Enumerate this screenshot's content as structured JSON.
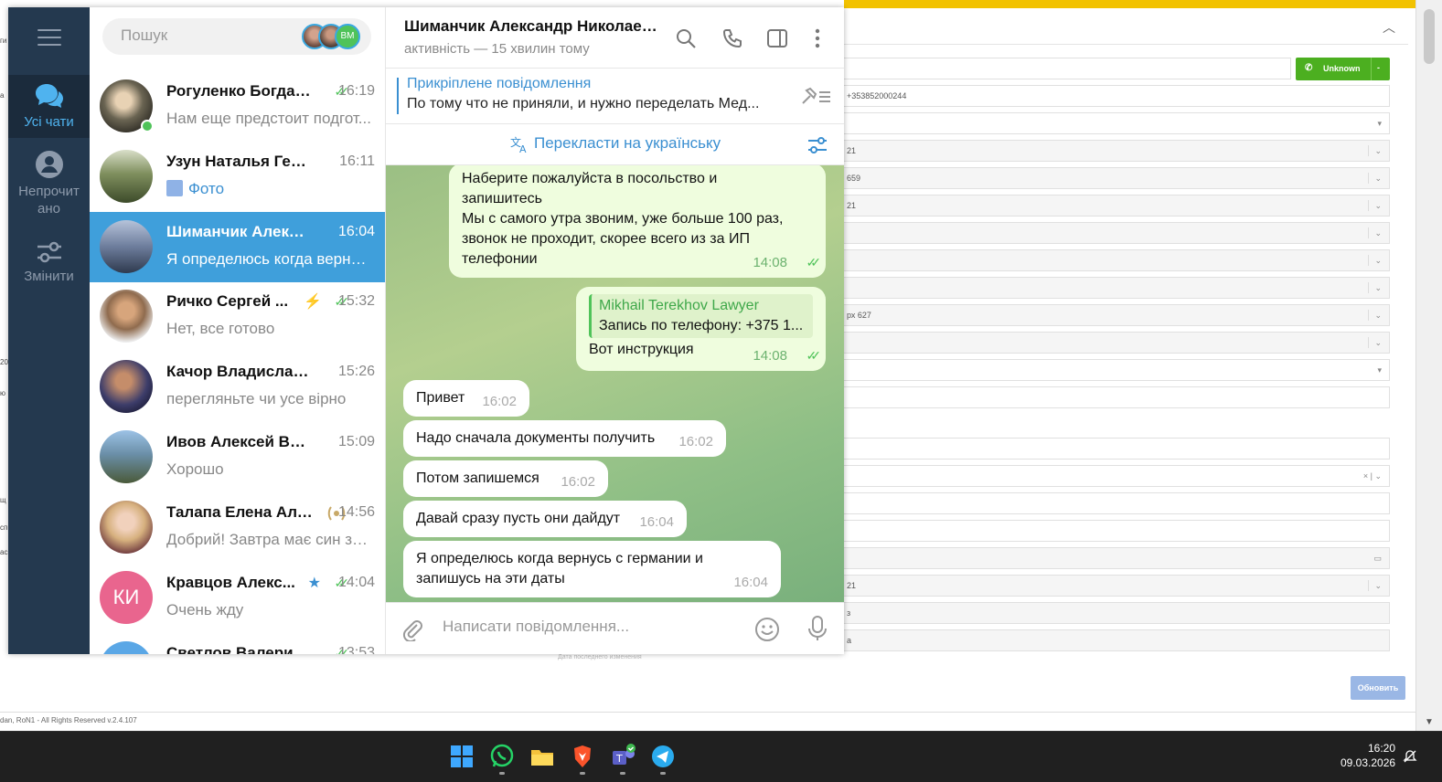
{
  "background_app": {
    "phone_value": "+353852000244",
    "unknown_label": "Unknown",
    "field_snippets": [
      "21",
      "659",
      "21",
      "рх 627",
      "21",
      "з",
      "а"
    ],
    "update_label": "Обновить",
    "footer": "dan, RoN1 - All Rights Reserved v.2.4.107",
    "left_scraps": [
      "ги",
      "а",
      "20",
      "ю",
      "щ",
      "сп",
      "ас"
    ],
    "bottom_scrap": "Дата последнего изменения"
  },
  "telegram": {
    "rail": [
      {
        "label": "Усі чати",
        "icon": "chats-icon"
      },
      {
        "label": "Непрочит ано",
        "icon": "unread-icon"
      },
      {
        "label": "Змінити",
        "icon": "edit-filters-icon"
      }
    ],
    "search": {
      "placeholder": "Пошук",
      "mini_avatar_text": "ВМ"
    },
    "chats": [
      {
        "name": "Рогуленко Богдан...",
        "time": "16:19",
        "preview": "Нам еще предстоит подгот...",
        "ticks": "✓✓"
      },
      {
        "name": "Узун Наталья Георги...",
        "time": "16:11",
        "preview": "Фото"
      },
      {
        "name": "Шиманчик Александ...",
        "time": "16:04",
        "preview": "Я определюсь когда вернус..."
      },
      {
        "name": "Ричко Сергей ...",
        "time": "15:32",
        "preview": "Нет, все готово",
        "ticks": "✓✓",
        "badge": "⚡"
      },
      {
        "name": "Качор Владислав Ол...",
        "time": "15:26",
        "preview": "перегляньте чи усе вірно"
      },
      {
        "name": "Ивов Алексей Викто...",
        "time": "15:09",
        "preview": "Хорошо"
      },
      {
        "name": "Талапа Елена Але...",
        "time": "14:56",
        "preview": "Добрий! Завтра має син за..."
      },
      {
        "name": "Кравцов Алекс...",
        "time": "14:04",
        "preview": "Очень жду",
        "ticks": "✓✓",
        "badge": "★",
        "initials": "КИ"
      },
      {
        "name": "Светлов Валерий...",
        "time": "13:53",
        "ticks": "✓✓"
      }
    ],
    "chat": {
      "title": "Шиманчик Александр Николаев...",
      "status": "активність — 15 хвилин тому",
      "pinned_title": "Прикріплене повідомлення",
      "pinned_text": "По тому что не приняли, и нужно переделать Мед...",
      "translate_label": "Перекласти на українську",
      "messages": [
        {
          "dir": "out",
          "text_lines": [
            "Наберите пожалуйста в посольство и",
            "запишитесь",
            "Мы с самого утра звоним, уже больше 100 раз,",
            "звонок не проходит, скорее всего из за ИП",
            "телефонии"
          ],
          "time": "14:08",
          "ticks": "✓✓"
        },
        {
          "dir": "out",
          "quote_author": "Mikhail Terekhov Lawyer",
          "quote_text": "Запись по телефону: +375 1...",
          "text": "Вот инструкция",
          "time": "14:08",
          "ticks": "✓✓"
        },
        {
          "dir": "in",
          "text": "Привет",
          "time": "16:02"
        },
        {
          "dir": "in",
          "text": "Надо сначала документы получить",
          "time": "16:02"
        },
        {
          "dir": "in",
          "text": "Потом запишемся",
          "time": "16:02"
        },
        {
          "dir": "in",
          "text": "Давай сразу пусть они дайдут",
          "time": "16:04"
        },
        {
          "dir": "in",
          "text_lines": [
            "Я определюсь когда вернусь с германии и",
            "запишусь на эти даты"
          ],
          "time": "16:04"
        }
      ],
      "composer_placeholder": "Написати повідомлення..."
    }
  },
  "taskbar": {
    "apps": [
      "windows-start-icon",
      "whatsapp-icon",
      "file-explorer-icon",
      "brave-browser-icon",
      "teams-icon",
      "telegram-icon"
    ],
    "time": "16:20",
    "date": "09.03.2026"
  },
  "colors": {
    "telegram_rail": "#24394f",
    "telegram_accent": "#3f9fdb",
    "tick_green": "#4fc359",
    "crm_yellow": "#f2c200",
    "crm_green_button": "#4caf20"
  }
}
